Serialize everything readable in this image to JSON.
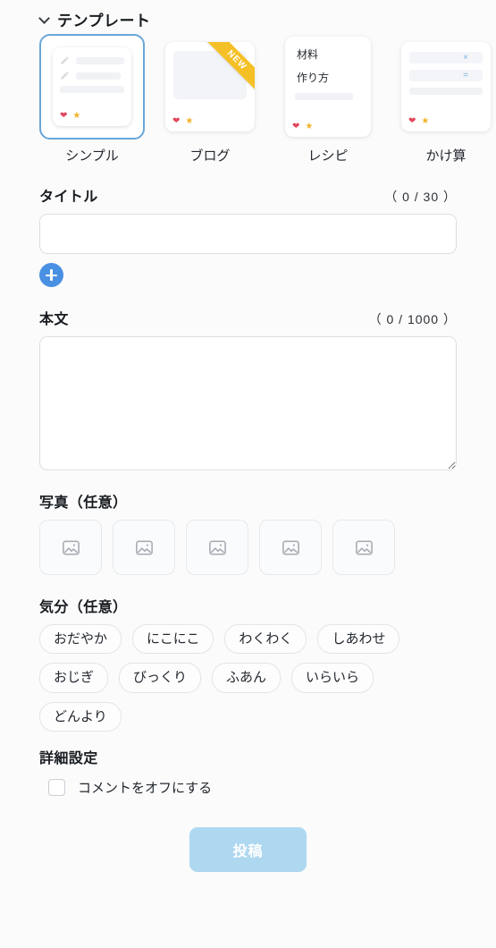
{
  "template_section": {
    "heading": "テンプレート",
    "collapse_icon": "chevron-down-icon",
    "items": [
      {
        "label": "シンプル",
        "selected": true,
        "badge": null,
        "kind": "simple",
        "reactions": [
          "❤",
          "★"
        ]
      },
      {
        "label": "ブログ",
        "selected": false,
        "badge": "NEW",
        "kind": "blog",
        "reactions": [
          "❤",
          "★"
        ]
      },
      {
        "label": "レシピ",
        "selected": false,
        "badge": null,
        "kind": "recipe",
        "lines": [
          "材料",
          "作り方"
        ],
        "reactions": [
          "❤",
          "★"
        ]
      },
      {
        "label": "かけ算",
        "selected": false,
        "badge": null,
        "kind": "math",
        "symbols": [
          "×",
          "="
        ],
        "reactions": [
          "❤",
          "★"
        ]
      }
    ]
  },
  "title_field": {
    "label": "タイトル",
    "counter": "（ 0 / 30 ）",
    "value": "",
    "placeholder": "",
    "add_button_icon": "plus-icon"
  },
  "body_field": {
    "label": "本文",
    "counter": "（ 0 / 1000 ）",
    "value": "",
    "placeholder": ""
  },
  "photo_section": {
    "label": "写真（任意）",
    "slot_icon": "image-placeholder-icon",
    "slots": [
      1,
      2,
      3,
      4,
      5
    ]
  },
  "mood_section": {
    "label": "気分（任意）",
    "chips": [
      "おだやか",
      "にこにこ",
      "わくわく",
      "しあわせ",
      "おじぎ",
      "びっくり",
      "ふあん",
      "いらいら",
      "どんより"
    ]
  },
  "advanced_section": {
    "label": "詳細設定",
    "checkbox_label": "コメントをオフにする",
    "checked": false
  },
  "submit": {
    "label": "投稿",
    "disabled": true
  },
  "colors": {
    "background": "#fbfbfb",
    "accent_blue": "#4a90e2",
    "selected_border": "#6aa6d8",
    "submit_disabled": "#aed8f0",
    "ribbon_yellow": "#f5c025",
    "heart_red": "#e0475b",
    "star_yellow": "#f0b429",
    "border_gray": "#dcdfe3"
  }
}
